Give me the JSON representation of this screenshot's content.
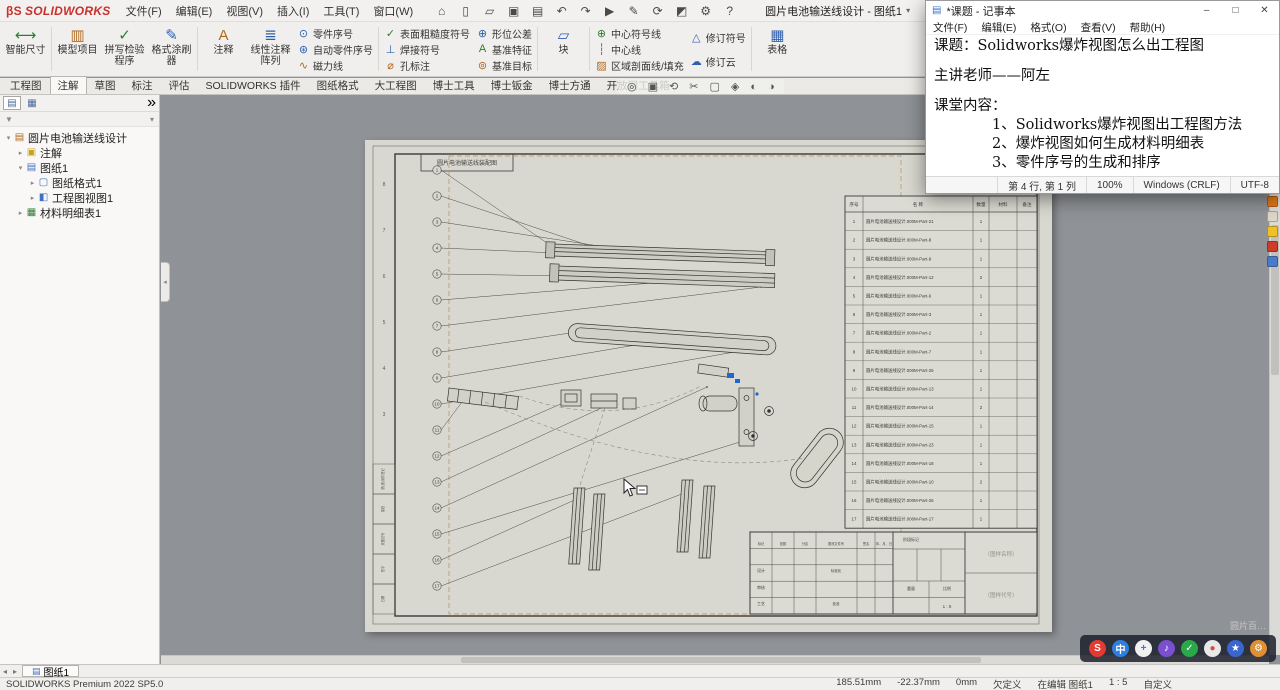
{
  "titlebar": {
    "logo_mark": "DS",
    "logo": "SOLIDWORKS",
    "menus": [
      "文件(F)",
      "编辑(E)",
      "视图(V)",
      "插入(I)",
      "工具(T)",
      "窗口(W)"
    ],
    "qat_icons": [
      {
        "name": "home-icon",
        "glyph": "⌂"
      },
      {
        "name": "new-file-icon",
        "glyph": "▯"
      },
      {
        "name": "open-file-icon",
        "glyph": "▱"
      },
      {
        "name": "save-icon",
        "glyph": "▣"
      },
      {
        "name": "print-icon",
        "glyph": "▤"
      },
      {
        "name": "undo-icon",
        "glyph": "↶"
      },
      {
        "name": "redo-icon",
        "glyph": "↷"
      },
      {
        "name": "select-arrow-icon",
        "glyph": "▶"
      },
      {
        "name": "sketch-icon",
        "glyph": "✎"
      },
      {
        "name": "rebuild-icon",
        "glyph": "⟳"
      },
      {
        "name": "appearance-icon",
        "glyph": "◩"
      },
      {
        "name": "options-gear-icon",
        "glyph": "⚙"
      },
      {
        "name": "help-icon",
        "glyph": "?"
      }
    ],
    "doc_title": "圆片电池输送线设计 - 图纸1",
    "doc_caret": "▾"
  },
  "ribbon": {
    "buttons": [
      {
        "type": "large",
        "name": "smart-dimension-button",
        "label": "智能尺寸",
        "icon": "⟷",
        "color": "#2e7d32",
        "sep": true
      },
      {
        "type": "large",
        "name": "model-items-button",
        "label": "模型项目",
        "icon": "▥",
        "color": "#b06a1e"
      },
      {
        "type": "large",
        "name": "spell-checker-button",
        "label": "拼写检验程序",
        "icon": "✓",
        "color": "#2e7d32"
      },
      {
        "type": "large",
        "name": "format-painter-button",
        "label": "格式涂刷器",
        "icon": "✎",
        "color": "#2f5fae",
        "sep": true
      },
      {
        "type": "large",
        "name": "note-button",
        "label": "注释",
        "icon": "A",
        "color": "#b06a1e"
      },
      {
        "type": "large",
        "name": "linear-note-pattern-button",
        "label": "线性注释阵列",
        "icon": "≣",
        "color": "#2f5fae"
      },
      {
        "type": "col",
        "name": "balloon-column",
        "sep": true,
        "items": [
          {
            "name": "balloon-button",
            "label": "零件序号",
            "icon": "⊙",
            "color": "#2f5fae"
          },
          {
            "name": "auto-balloon-button",
            "label": "自动零件序号",
            "icon": "⊛",
            "color": "#2f5fae"
          },
          {
            "name": "magnetic-line-button",
            "label": "磁力线",
            "icon": "∿",
            "color": "#b06a1e"
          }
        ]
      },
      {
        "type": "col",
        "name": "symbol-column",
        "items": [
          {
            "name": "surface-finish-button",
            "label": "表面粗糙度符号",
            "icon": "✓",
            "color": "#2e7d32"
          },
          {
            "name": "weld-symbol-button",
            "label": "焊接符号",
            "icon": "⊥",
            "color": "#2f5fae"
          },
          {
            "name": "hole-callout-button",
            "label": "孔标注",
            "icon": "⌀",
            "color": "#b06a1e"
          }
        ]
      },
      {
        "type": "col",
        "name": "datum-column",
        "sep": true,
        "items": [
          {
            "name": "geometric-tolerance-button",
            "label": "形位公差",
            "icon": "⊕",
            "color": "#2f5fae"
          },
          {
            "name": "datum-feature-button",
            "label": "基准特征",
            "icon": "A",
            "color": "#2e7d32"
          },
          {
            "name": "datum-target-button",
            "label": "基准目标",
            "icon": "⊚",
            "color": "#b06a1e"
          }
        ]
      },
      {
        "type": "large",
        "name": "blocks-button",
        "label": "块",
        "icon": "▱",
        "color": "#2f5fae",
        "sep": true
      },
      {
        "type": "col",
        "name": "centerline-column",
        "items": [
          {
            "name": "center-mark-button",
            "label": "中心符号线",
            "icon": "⊕",
            "color": "#2e7d32"
          },
          {
            "name": "centerline-button",
            "label": "中心线",
            "icon": "┆",
            "color": "#2f5fae"
          },
          {
            "name": "area-hatch-button",
            "label": "区域剖面线/填充",
            "icon": "▨",
            "color": "#b06a1e"
          }
        ]
      },
      {
        "type": "col",
        "name": "revision-column",
        "sep": true,
        "items": [
          {
            "name": "revision-symbol-button",
            "label": "修订符号",
            "icon": "△",
            "color": "#2f5fae"
          },
          {
            "name": "revision-cloud-button",
            "label": "修订云",
            "icon": "☁",
            "color": "#2f5fae"
          }
        ]
      },
      {
        "type": "large",
        "name": "tables-button",
        "label": "表格",
        "icon": "▦",
        "color": "#2f5fae"
      }
    ]
  },
  "tabs": {
    "active": 1,
    "items": [
      "工程图",
      "注解",
      "草图",
      "标注",
      "评估",
      "SOLIDWORKS 插件",
      "图纸格式",
      "大工程图",
      "博士工具",
      "博士钣金",
      "博士方通",
      "开放网工具箱"
    ]
  },
  "viewbar": [
    {
      "name": "zoom-fit-icon",
      "glyph": "◎"
    },
    {
      "name": "zoom-area-icon",
      "glyph": "▣"
    },
    {
      "name": "previous-view-icon",
      "glyph": "⟲"
    },
    {
      "name": "section-view-icon",
      "glyph": "✂"
    },
    {
      "name": "view-orientation-icon",
      "glyph": "▢"
    },
    {
      "name": "display-style-icon",
      "glyph": "◈"
    },
    {
      "name": "hide-show-icon",
      "glyph": "◐"
    },
    {
      "name": "edit-appearance-icon",
      "glyph": "◑"
    }
  ],
  "panel": {
    "tabs": [
      {
        "name": "feature-tree-tab",
        "glyph": "▤"
      },
      {
        "name": "property-manager-tab",
        "glyph": "▦"
      }
    ],
    "filter_caret": "▾"
  },
  "tree": {
    "items": [
      {
        "name": "tree-root-assembly",
        "label": "圆片电池输送线设计",
        "icon": "▤",
        "icon_name": "drawing-doc-icon",
        "color": "#b06a1e",
        "depth": 0,
        "exp": "▾"
      },
      {
        "name": "tree-annotations",
        "label": "注解",
        "icon": "▣",
        "icon_name": "annotations-folder-icon",
        "color": "#c8a020",
        "depth": 1,
        "exp": "▸"
      },
      {
        "name": "tree-sheet1",
        "label": "图纸1",
        "icon": "▤",
        "icon_name": "sheet-icon",
        "color": "#4070c0",
        "depth": 1,
        "exp": "▾"
      },
      {
        "name": "tree-sheet-format1",
        "label": "图纸格式1",
        "icon": "▢",
        "icon_name": "sheet-format-icon",
        "color": "#4070c0",
        "depth": 2,
        "exp": "▸"
      },
      {
        "name": "tree-drawing-view1",
        "label": "工程图视图1",
        "icon": "◧",
        "icon_name": "drawing-view-icon",
        "color": "#4070c0",
        "depth": 2,
        "exp": "▸"
      },
      {
        "name": "tree-bom-table1",
        "label": "材料明细表1",
        "icon": "▦",
        "icon_name": "bom-table-icon",
        "color": "#2e7d32",
        "depth": 1,
        "exp": "▸"
      }
    ]
  },
  "sheet": {
    "label": "圆片电池输送线装配图",
    "zones": [
      "8",
      "7",
      "6",
      "5",
      "4",
      "3"
    ],
    "margin_labels": [
      "日期",
      "签字",
      "底图总号",
      "描校",
      "借(通)用件登记"
    ]
  },
  "bom": {
    "headers": [
      "序号",
      "名  称",
      "数量",
      "材料",
      "备注"
    ],
    "rows": [
      {
        "no": "1",
        "name": "圆片电池输送线设计.000M-Part-21",
        "qty": "1"
      },
      {
        "no": "2",
        "name": "圆片电池输送线设计.000M-Part-8",
        "qty": "1"
      },
      {
        "no": "3",
        "name": "圆片电池输送线设计.000M-Part-9",
        "qty": "1"
      },
      {
        "no": "4",
        "name": "圆片电池输送线设计.000M-Part-12",
        "qty": "2"
      },
      {
        "no": "5",
        "name": "圆片电池输送线设计.000M-Part-6",
        "qty": "1"
      },
      {
        "no": "6",
        "name": "圆片电池输送线设计.000M-Part-3",
        "qty": "1"
      },
      {
        "no": "7",
        "name": "圆片电池输送线设计.000M-Part-2",
        "qty": "1"
      },
      {
        "no": "8",
        "name": "圆片电池输送线设计.000M-Part-7",
        "qty": "1"
      },
      {
        "no": "9",
        "name": "圆片电池输送线设计.000M-Part-25",
        "qty": "1"
      },
      {
        "no": "10",
        "name": "圆片电池输送线设计.000M-Part-13",
        "qty": "1"
      },
      {
        "no": "11",
        "name": "圆片电池输送线设计.000M-Part-14",
        "qty": "2"
      },
      {
        "no": "12",
        "name": "圆片电池输送线设计.000M-Part-15",
        "qty": "1"
      },
      {
        "no": "13",
        "name": "圆片电池输送线设计.000M-Part-23",
        "qty": "1"
      },
      {
        "no": "14",
        "name": "圆片电池输送线设计.000M-Part-18",
        "qty": "1"
      },
      {
        "no": "15",
        "name": "圆片电池输送线设计.000M-Part-10",
        "qty": "2"
      },
      {
        "no": "16",
        "name": "圆片电池输送线设计.000M-Part-26",
        "qty": "1"
      },
      {
        "no": "17",
        "name": "圆片电池输送线设计.000M-Part-17",
        "qty": "1"
      }
    ]
  },
  "titleblock": {
    "labels": [
      "标记",
      "处数",
      "分区",
      "更改文件号",
      "签名",
      "年、月、日",
      "设计",
      "审核",
      "工艺",
      "标准化",
      "批准",
      "阶段标记",
      "重量",
      "比例",
      "1 : 5",
      "（图样名称）",
      "（图样代号）"
    ]
  },
  "notepad": {
    "title": "*课题 - 记事本",
    "menus": [
      "文件(F)",
      "编辑(E)",
      "格式(O)",
      "查看(V)",
      "帮助(H)"
    ],
    "controls": [
      "–",
      "□",
      "✕"
    ],
    "body": [
      "课题：Solidworks爆炸视图怎么出工程图",
      "",
      "主讲老师——阿左",
      "",
      "课堂内容：",
      "　　　　1、Solidworks爆炸视图出工程图方法",
      "　　　　2、爆炸视图如何生成材料明细表",
      "　　　　3、零件序号的生成和排序"
    ],
    "status": [
      "第 4 行, 第 1 列",
      "100%",
      "Windows (CRLF)",
      "UTF-8"
    ]
  },
  "sheettab": {
    "label": "图纸1"
  },
  "statusbar": {
    "product": "SOLIDWORKS Premium 2022 SP5.0",
    "items": [
      "185.51mm",
      "-22.37mm",
      "0mm",
      "欠定义",
      "在编辑 图纸1",
      "1 : 5",
      "自定义"
    ]
  },
  "taskbar": {
    "watermark": "圆片百…",
    "icons": [
      {
        "name": "recorder-logo-icon",
        "glyph": "S",
        "bg": "#e23b34",
        "fg": "#ffffff"
      },
      {
        "name": "chat-app-icon",
        "glyph": "中",
        "bg": "#2d7fe0",
        "fg": "#ffffff"
      },
      {
        "name": "meeting-app-icon",
        "glyph": "+",
        "bg": "#f0f0f0",
        "fg": "#2d7fe0"
      },
      {
        "name": "music-app-icon",
        "glyph": "♪",
        "bg": "#7a4fd0",
        "fg": "#ffffff"
      },
      {
        "name": "check-app-icon",
        "glyph": "✓",
        "bg": "#2aa84a",
        "fg": "#ffffff"
      },
      {
        "name": "dot-app-icon",
        "glyph": "●",
        "bg": "#e8e8e8",
        "fg": "#d04f4f"
      },
      {
        "name": "star-app-icon",
        "glyph": "★",
        "bg": "#3b66d0",
        "fg": "#ffffff"
      },
      {
        "name": "gear-app-icon",
        "glyph": "⚙",
        "bg": "#e09030",
        "fg": "#ffffff"
      }
    ]
  },
  "dock_icons": [
    "#e07818",
    "#ded6c6",
    "#f0c028",
    "#cc3c28",
    "#4a7ac8"
  ]
}
